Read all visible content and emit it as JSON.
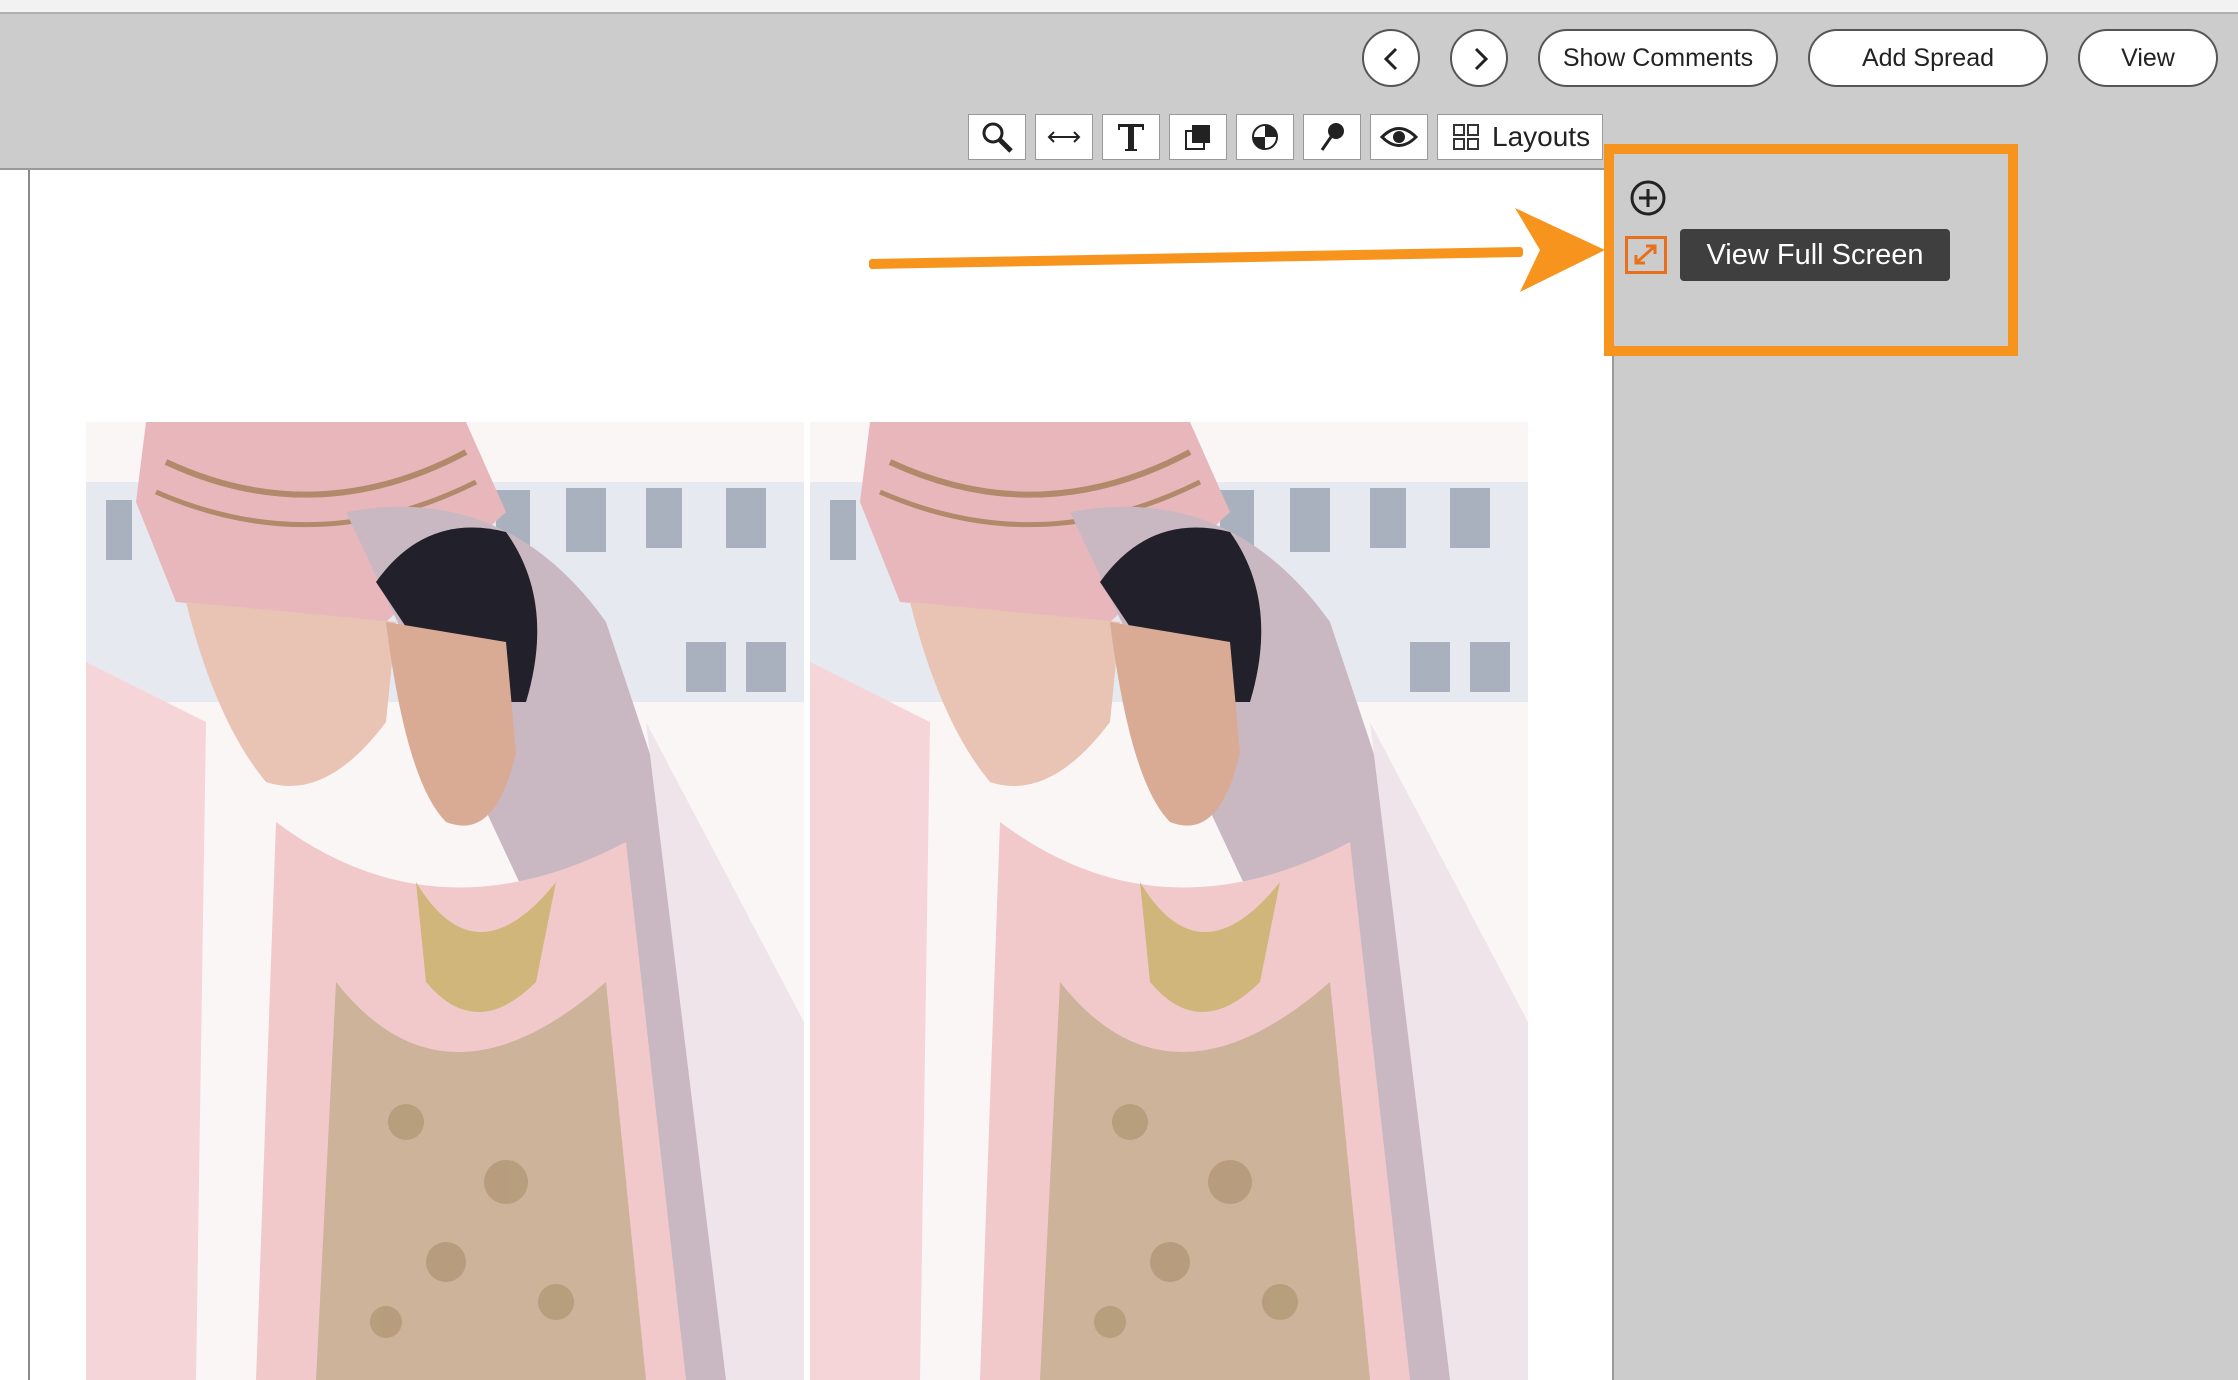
{
  "header": {
    "prev_label": "Previous",
    "next_label": "Next",
    "show_comments": "Show Comments",
    "add_spread": "Add Spread",
    "view": "View"
  },
  "toolbar": {
    "tools": [
      "zoom-icon",
      "fit-width-icon",
      "text-icon",
      "layer-icon",
      "contrast-icon",
      "pin-icon",
      "eye-icon"
    ],
    "layouts_label": "Layouts"
  },
  "side_panel": {
    "add_icon": "plus-circle-icon",
    "fullscreen_icon": "expand-icon",
    "tooltip": "View Full Screen"
  },
  "annotation": {
    "arrow_color": "#f7941d",
    "box_color": "#f7941d"
  },
  "spread": {
    "photos": [
      "wedding-couple-photo-left",
      "wedding-couple-photo-right"
    ]
  }
}
